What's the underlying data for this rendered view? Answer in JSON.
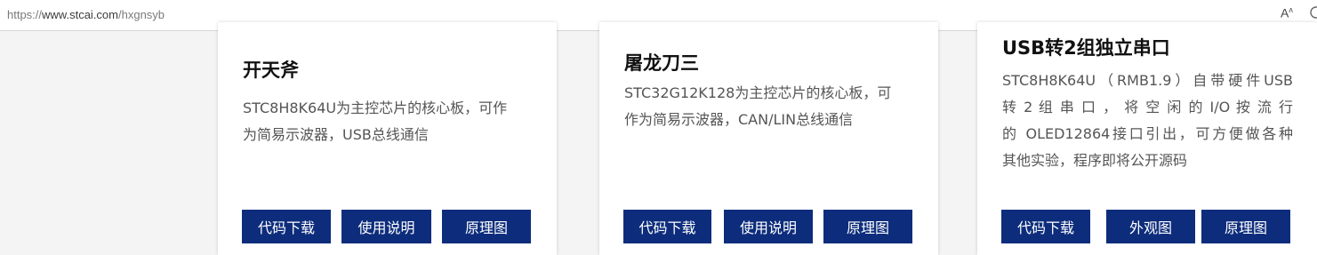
{
  "browser": {
    "url_scheme": "https://",
    "url_host": "www.stcai.com",
    "url_path": "/hxgnsyb",
    "read_aloud": "A",
    "read_aloud_sup": "ʌ"
  },
  "cards": [
    {
      "title": "开天斧",
      "desc_lines": [
        "STC8H8K64U为主控芯片的核心板，可作",
        "为简易示波器，USB总线通信"
      ],
      "buttons": [
        "代码下载",
        "使用说明",
        "原理图"
      ]
    },
    {
      "title": "屠龙刀三",
      "desc_lines": [
        "STC32G12K128为主控芯片的核心板，可",
        "作为简易示波器，CAN/LIN总线通信"
      ],
      "buttons": [
        "代码下载",
        "使用说明",
        "原理图"
      ]
    },
    {
      "title": "USB转2组独立串口",
      "desc_lines": [
        "STC8H8K64U（RMB1.9）自带硬件USB",
        "转 2 组 串 口 ， 将 空 闲 的 I/O 按 流 行",
        "的 OLED12864接口引出，可方便做各种",
        "其他实验，程序即将公开源码"
      ],
      "buttons": [
        "代码下载",
        "外观图",
        "原理图"
      ]
    }
  ],
  "colors": {
    "button_bg": "#0d2d7c",
    "page_bg": "#f4f4f4"
  }
}
